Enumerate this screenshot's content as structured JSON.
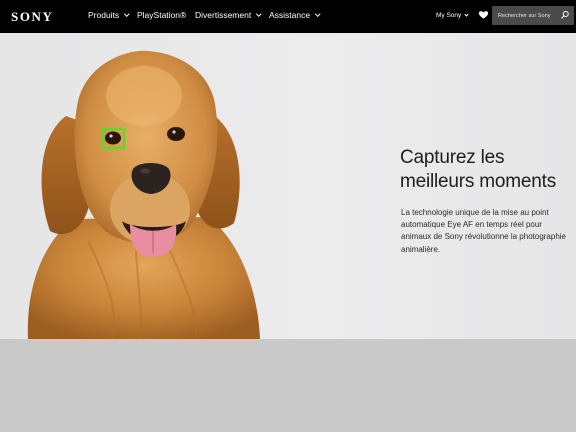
{
  "header": {
    "logo": "SONY",
    "nav": [
      {
        "label": "Produits",
        "has_caret": true
      },
      {
        "label": "PlayStation®",
        "has_caret": false
      },
      {
        "label": "Divertissement",
        "has_caret": true
      },
      {
        "label": "Assistance",
        "has_caret": true
      }
    ],
    "my_sony": "My Sony",
    "favorites_icon": "heart-icon",
    "search_label": "Rechercher sur Sony",
    "search_icon": "search-icon"
  },
  "hero": {
    "headline_line1": "Capturez les",
    "headline_line2": "meilleurs moments",
    "body": "La technologie unique de la mise au point automatique Eye AF en temps réel pour animaux de Sony révolutionne la photographie animalière.",
    "focus_box_color": "#5fd82a"
  },
  "colors": {
    "nav_bg": "#000000",
    "search_bg": "#4a4a4a",
    "hero_bg": "#e9e9ea",
    "lower_band": "#c9c9c9"
  }
}
